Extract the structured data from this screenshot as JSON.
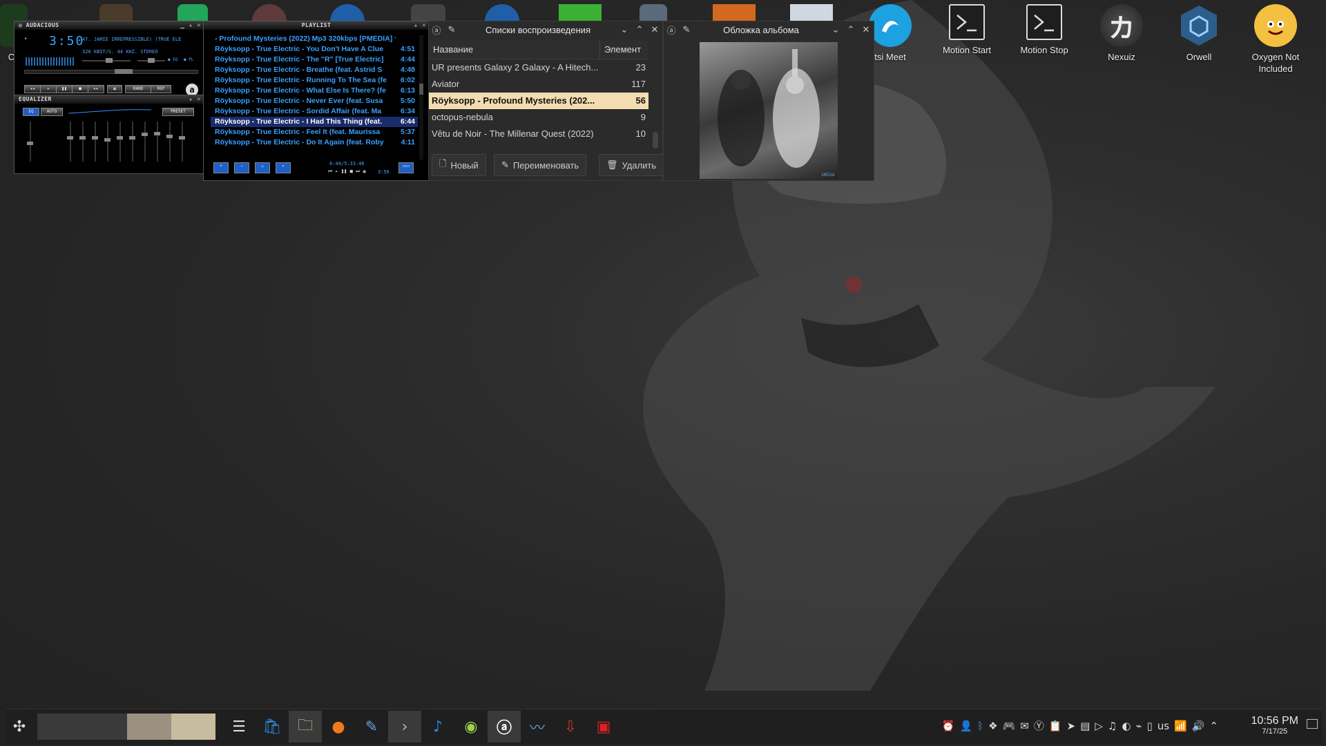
{
  "desktop": {
    "icons": [
      {
        "label": "Ca",
        "color": "#1d3b1d"
      },
      {
        "label": "",
        "color": "#4b3b2b"
      },
      {
        "label": "",
        "color": "#23a55a"
      },
      {
        "label": "",
        "color": "#603a3a"
      },
      {
        "label": "",
        "color": "#1f5fa8"
      },
      {
        "label": "",
        "color": "#444"
      },
      {
        "label": "",
        "color": "#1f5fa8"
      },
      {
        "label": "",
        "color": "#3cb034"
      },
      {
        "label": "",
        "color": "#5a6a7a"
      },
      {
        "label": "",
        "color": "#d2691e"
      },
      {
        "label": "",
        "color": "#cfd8e0"
      },
      {
        "label": "tsi Meet",
        "color": "#1da1e0"
      },
      {
        "label": "Motion Start",
        "color": "#1e1e1e"
      },
      {
        "label": "Motion Stop",
        "color": "#1e1e1e"
      },
      {
        "label": "Nexuiz",
        "color": "#2b2b2b"
      },
      {
        "label": "Orwell",
        "color": "#2c5e8c"
      },
      {
        "label": "Oxygen Not Included",
        "color": "#f3c040"
      }
    ]
  },
  "audacious": {
    "title": "AUDACIOUS",
    "time": "3:50",
    "marquee": "AT. JAMIE IRREPRESSIBLE) (TRUE ELE",
    "info": "320 KBIT/S. 44 KHZ. STEREO",
    "eq_toggle": "EQ",
    "pl_toggle": "PL",
    "rand": "RAND",
    "rep": "REP",
    "equalizer": {
      "title": "EQUALIZER",
      "eq": "EQ",
      "auto": "AUTO",
      "preset": "PRESET",
      "bands": [
        0.55,
        0.4,
        0.4,
        0.4,
        0.45,
        0.4,
        0.4,
        0.3,
        0.28,
        0.35,
        0.4
      ]
    }
  },
  "playlist": {
    "title": "PLAYLIST",
    "rows": [
      {
        "title": "- Profound Mysteries (2022) Mp3 320kbps [PMEDIA] ⭐",
        "duration": ""
      },
      {
        "title": "Röyksopp - True Electric - You Don't Have A Clue",
        "duration": "4:51"
      },
      {
        "title": "Röyksopp - True Electric - The \"R\" [True Electric]",
        "duration": "4:44"
      },
      {
        "title": "Röyksopp - True Electric - Breathe (feat. Astrid S",
        "duration": "4:48"
      },
      {
        "title": "Röyksopp - True Electric - Running To The Sea (fe",
        "duration": "6:02"
      },
      {
        "title": "Röyksopp - True Electric - What Else Is There? (fe",
        "duration": "6:13"
      },
      {
        "title": "Röyksopp - True Electric - Never Ever (feat. Susa",
        "duration": "5:50"
      },
      {
        "title": "Röyksopp - True Electric - Sordid Affair (feat. Ma",
        "duration": "6:34"
      },
      {
        "title": "Röyksopp - True Electric - I Had This Thing (feat.",
        "duration": "6:44"
      },
      {
        "title": "Röyksopp - True Electric - Feel It (feat. Maurissa",
        "duration": "5:37"
      },
      {
        "title": "Röyksopp - True Electric - Do It Again (feat. Roby",
        "duration": "4:11"
      }
    ],
    "current_index": 8,
    "footer_time": "6:44/5:33:46",
    "footer_elapsed": "3:56"
  },
  "playlists_panel": {
    "title": "Списки воспроизведения",
    "col_name": "Название",
    "col_count": "Элемент",
    "rows": [
      {
        "name": "UR presents Galaxy 2 Galaxy - A Hitech...",
        "count": "23"
      },
      {
        "name": "Aviator",
        "count": "117"
      },
      {
        "name": "Röyksopp - Profound Mysteries (202...",
        "count": "56"
      },
      {
        "name": "octopus-nebula",
        "count": "9"
      },
      {
        "name": "Vêtu de Noir - The Millenar Quest (2022)",
        "count": "10"
      }
    ],
    "selected_index": 2,
    "btn_new": "Новый",
    "btn_rename": "Переименовать",
    "btn_delete": "Удалить"
  },
  "album_panel": {
    "title": "Обложка альбома",
    "watermark": "MEDIA"
  },
  "taskbar": {
    "keyboard_layout": "us",
    "time": "10:56 PM",
    "date": "7/17/25"
  }
}
